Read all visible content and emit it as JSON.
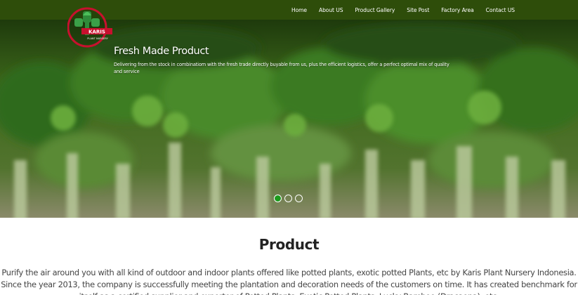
{
  "logo": {
    "brand": "KARIS",
    "subtitle": "PLANT NURSERY",
    "colors": {
      "ring": "#c8102e",
      "leaf": "#2e8b3a",
      "banner": "#c8102e"
    }
  },
  "nav": {
    "items": [
      {
        "label": "Home"
      },
      {
        "label": "About US"
      },
      {
        "label": "Product Gallery"
      },
      {
        "label": "Site Post"
      },
      {
        "label": "Factory Area"
      },
      {
        "label": "Contact US"
      }
    ]
  },
  "hero": {
    "title": "Fresh Made Product",
    "text": "Delivering from the stock in combinatiom with the fresh trade directly buyable from us, plus the efficient logistics, offer a perfect optimal mix of quality and service",
    "slides": {
      "count": 3,
      "active": 1
    }
  },
  "product": {
    "heading": "Product",
    "paragraph": "Purify the air around you with all kind of outdoor and indoor plants offered like potted plants, exotic potted Plants, etc by Karis Plant Nursery Indonesia. Since the year 2013, the company is successfully meeting the plantation and decoration needs of the customers on time. It has created benchmark for itself as a certified supplier and exporter of Potted Plants, Exotic Potted Plants, Lucky Bamboo (Dracaena), etc."
  },
  "colors": {
    "topbar": "#2e4d0a",
    "active_dot": "#1c9a1c"
  }
}
